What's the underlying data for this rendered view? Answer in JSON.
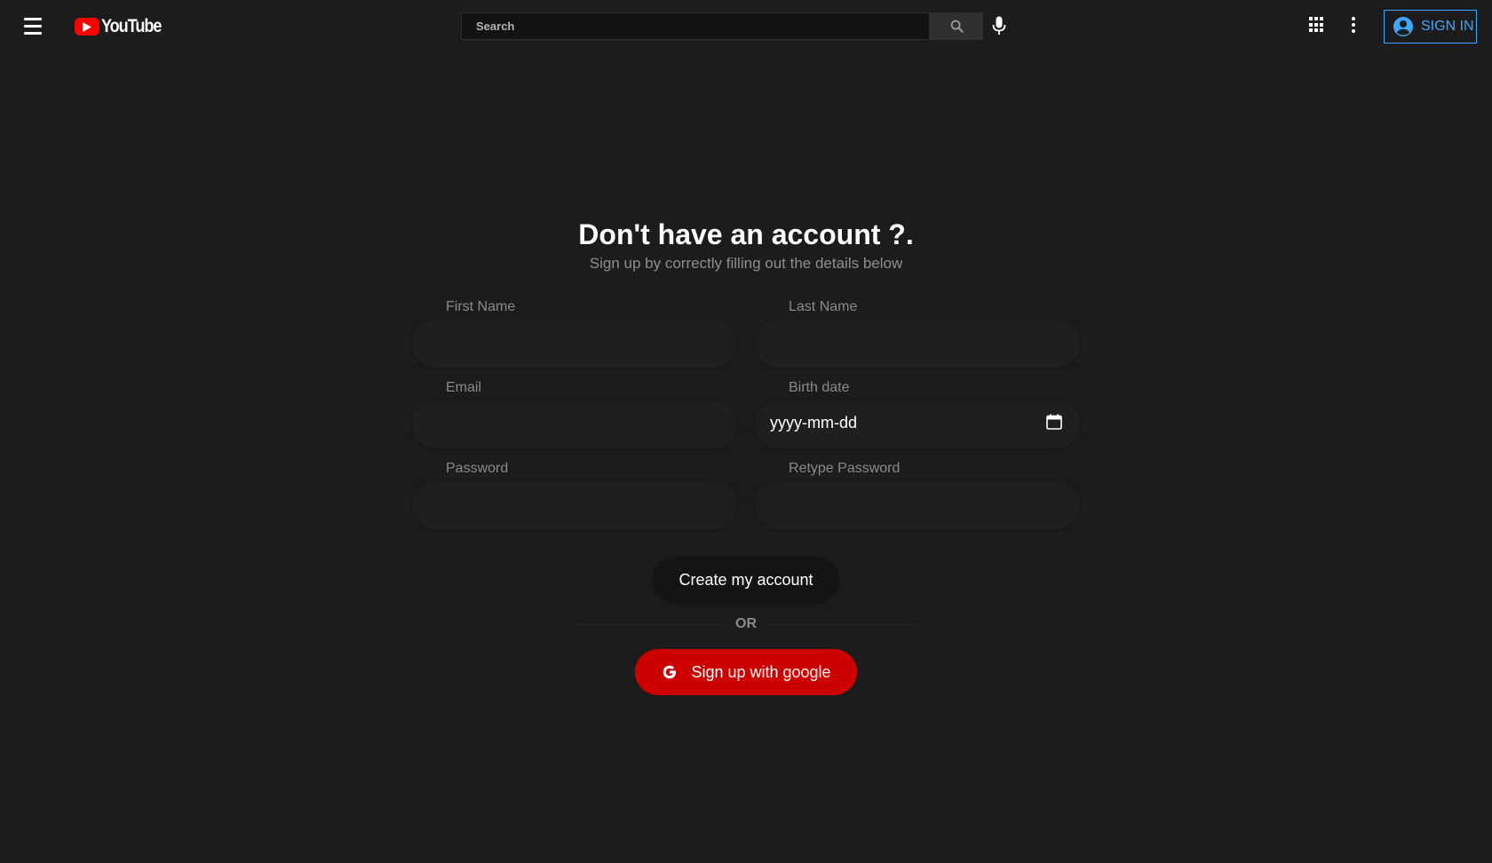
{
  "header": {
    "logo_text": "YouTube",
    "search_placeholder": "Search",
    "signin_label": "SIGN IN"
  },
  "form": {
    "title": "Don't have an account ?.",
    "subtitle": "Sign up by correctly filling out the details below",
    "fields": {
      "first_name": {
        "label": "First Name",
        "value": ""
      },
      "last_name": {
        "label": "Last Name",
        "value": ""
      },
      "email": {
        "label": "Email",
        "value": ""
      },
      "birth_date": {
        "label": "Birth date",
        "placeholder": "yyyy-mm-dd"
      },
      "password": {
        "label": "Password",
        "value": ""
      },
      "retype_password": {
        "label": "Retype Password",
        "value": ""
      }
    },
    "create_label": "Create my account",
    "or_label": "OR",
    "google_label": "Sign up with google"
  },
  "colors": {
    "background": "#1c1c1c",
    "brand_red": "#ff0000",
    "google_button": "#cc0000",
    "signin_blue": "#3ea6ff"
  },
  "icons": [
    "menu-icon",
    "youtube-logo-icon",
    "search-icon",
    "mic-icon",
    "apps-icon",
    "more-vert-icon",
    "account-circle-icon",
    "calendar-icon",
    "google-g-icon"
  ]
}
